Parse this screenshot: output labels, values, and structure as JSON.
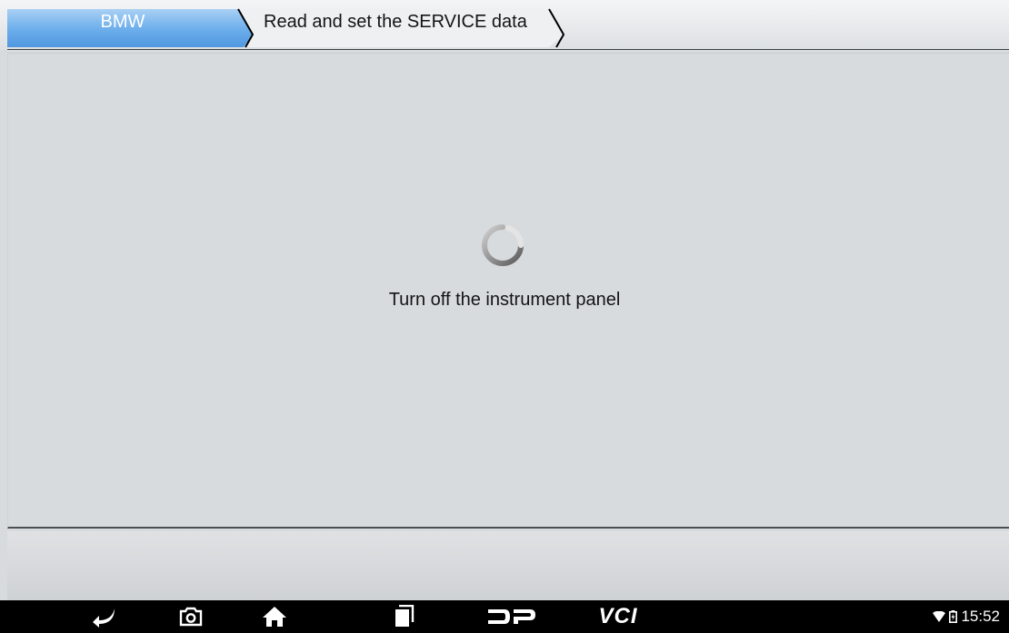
{
  "breadcrumb": {
    "items": [
      {
        "label": "BMW",
        "active": true
      },
      {
        "label": "Read and set the SERVICE data",
        "active": false
      }
    ]
  },
  "content": {
    "message": "Turn off the instrument panel",
    "spinner_icon": "loading-spinner-icon"
  },
  "navbar": {
    "buttons": [
      "back-icon",
      "screenshot-camera-icon",
      "home-icon",
      "recent-apps-icon",
      "dp-logo-icon",
      "vci-logo-icon"
    ],
    "vci_label": "VCI",
    "time": "15:52",
    "status_icons": [
      "wifi-icon",
      "battery-icon"
    ]
  },
  "colors": {
    "active_tab": "#5ea4e8",
    "background": "#d8dbde",
    "navbar": "#000000"
  }
}
